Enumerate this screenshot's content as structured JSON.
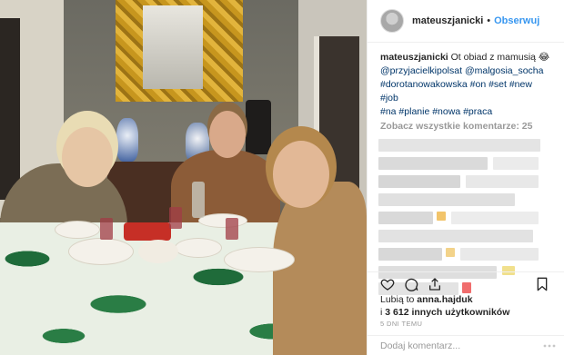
{
  "header": {
    "username": "mateuszjanicki",
    "separator": "•",
    "follow_label": "Obserwuj"
  },
  "caption": {
    "username": "mateuszjanicki",
    "text": "Ot obiad z mamusią 😂",
    "mention1": "@przyjacielkipolsat",
    "mention2": "@malgosia_socha",
    "tag_line": "#dorotanowakowska #on #set #new #job",
    "tag_line2": "#na #planie #nowa #praca"
  },
  "comments": {
    "view_all": "Zobacz wszystkie komentarze: 25"
  },
  "likes": {
    "prefix": "Lubią to",
    "user": "anna.hajduk",
    "connector": "i",
    "count": "3 612 innych użytkowników"
  },
  "time": "5 DNI TEMU",
  "comment_input": {
    "placeholder": "Dodaj komentarz..."
  },
  "icons": {
    "like": "heart-icon",
    "comment": "comment-icon",
    "share": "share-icon",
    "save": "bookmark-icon",
    "more": "more-dots-icon"
  }
}
